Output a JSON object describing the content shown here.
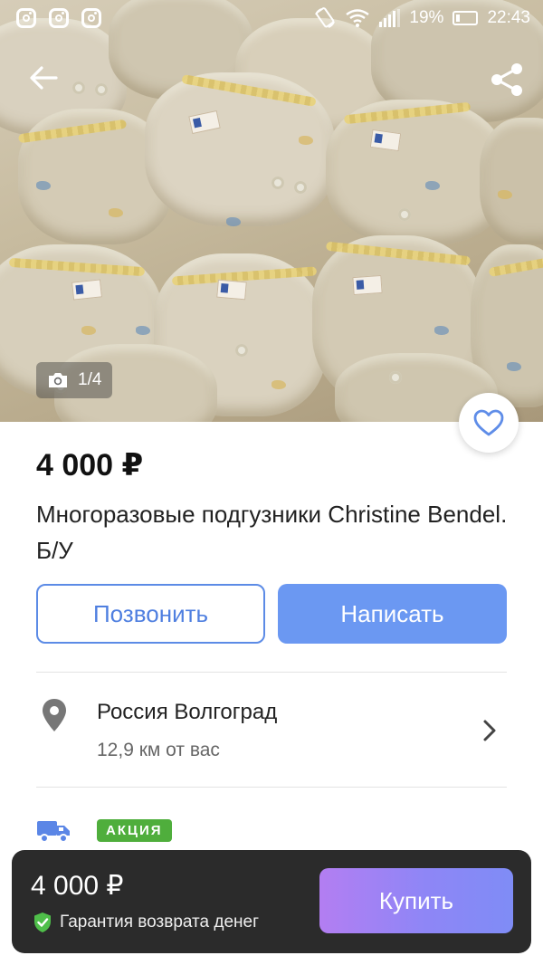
{
  "status_bar": {
    "battery": "19%",
    "time": "22:43",
    "left_icons": [
      "instagram-icon",
      "instagram-icon",
      "instagram-icon"
    ],
    "right_icons": [
      "rotate-icon",
      "wifi-icon",
      "signal-icon",
      "battery-icon"
    ]
  },
  "gallery": {
    "counter": "1/4",
    "counter_icon": "camera-icon"
  },
  "listing": {
    "price": "4 000 ₽",
    "title": "Многоразовые подгузники Christine Bendel. Б/У"
  },
  "actions": {
    "call_label": "Позвонить",
    "write_label": "Написать"
  },
  "location": {
    "city": "Россия Волгоград",
    "distance": "12,9 км от вас"
  },
  "delivery": {
    "badge": "АКЦИЯ"
  },
  "bottom_bar": {
    "price": "4 000 ₽",
    "guarantee": "Гарантия возврата денег",
    "buy_label": "Купить"
  },
  "colors": {
    "accent_blue": "#6b98f2",
    "call_border": "#5c8be6",
    "promo_green": "#4fae3c",
    "bottom_bar_bg": "#2b2b2b",
    "buy_gradient_start": "#b37ef2",
    "buy_gradient_end": "#7f8cf6"
  }
}
